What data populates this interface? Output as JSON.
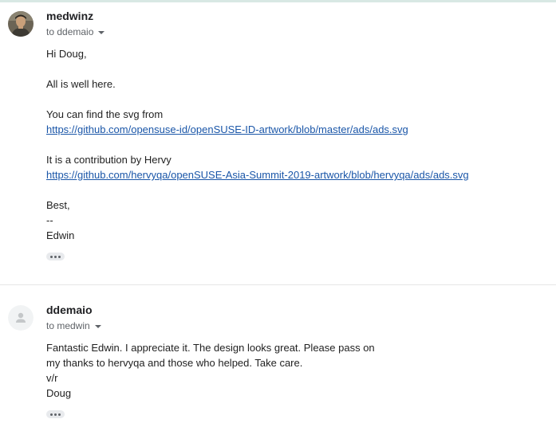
{
  "thread": {
    "messages": [
      {
        "sender": "medwinz",
        "recipient": "to ddemaio",
        "avatar_icon": "user-photo-avatar",
        "body_lines": [
          {
            "text": "Hi Doug,"
          },
          {
            "text": ""
          },
          {
            "text": "All is well here."
          },
          {
            "text": ""
          },
          {
            "text": "You can find the svg from"
          },
          {
            "link": "https://github.com/opensuse-id/openSUSE-ID-artwork/blob/master/ads/ads.svg"
          },
          {
            "text": ""
          },
          {
            "text": "It is a contribution by Hervy"
          },
          {
            "link": "https://github.com/hervyqa/openSUSE-Asia-Summit-2019-artwork/blob/hervyqa/ads/ads.svg"
          },
          {
            "text": ""
          },
          {
            "text": "Best,"
          },
          {
            "text": "--"
          },
          {
            "text": "Edwin"
          }
        ]
      },
      {
        "sender": "ddemaio",
        "recipient": "to medwin",
        "avatar_icon": "default-person-avatar",
        "body_lines": [
          {
            "text": "Fantastic Edwin. I appreciate it. The design looks great. Please pass on"
          },
          {
            "text": "my thanks to hervyqa and those who helped. Take care."
          },
          {
            "text": "v/r"
          },
          {
            "text": "Doug"
          }
        ]
      }
    ]
  },
  "colors": {
    "link": "#1a56a8",
    "meta_text": "#5f6368",
    "divider": "#e6e6e6"
  }
}
